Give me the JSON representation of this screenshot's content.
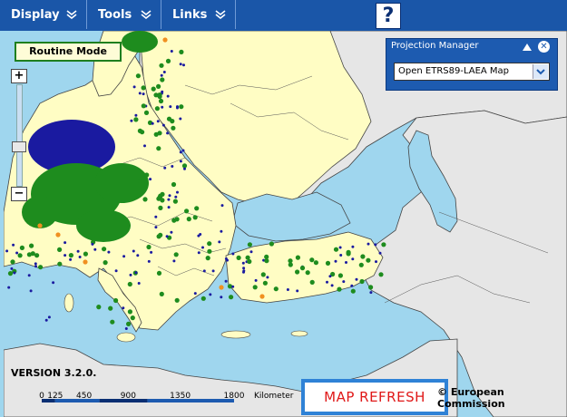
{
  "menus": [
    {
      "label": "Display"
    },
    {
      "label": "Tools"
    },
    {
      "label": "Links"
    }
  ],
  "help_label": "?",
  "routine_mode_label": "Routine Mode",
  "zoom": {
    "plus": "+",
    "minus": "−"
  },
  "projection_manager": {
    "title": "Projection Manager",
    "close_label": "✕",
    "selected_option": "Open ETRS89-LAEA Map"
  },
  "version_label": "VERSION 3.2.0.",
  "scale": {
    "ticks": [
      "0",
      "125",
      "450",
      "900",
      "1350",
      "1800"
    ],
    "unit": "Kilometer"
  },
  "map_refresh_label": "MAP REFRESH",
  "copyright": "© European Commission",
  "colors": {
    "toolbar": "#1a56a8",
    "sea": "#9fd6ee",
    "land_eu": "#fffdc4",
    "land_other": "#e6e6e6",
    "station_green": "#1e8c1e",
    "station_blue": "#1a1aa0",
    "station_orange": "#f09020"
  }
}
